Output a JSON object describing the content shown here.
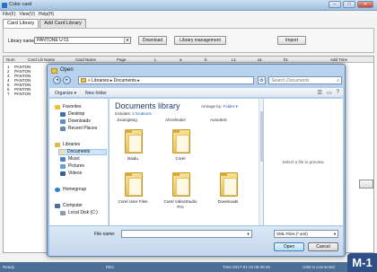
{
  "app": {
    "title": "Color card",
    "menu": [
      "File(F)",
      "View(V)",
      "Help(H)"
    ],
    "tabs": [
      "Card Library",
      "Add Card Library"
    ],
    "library_label": "Library name:",
    "library_value": "PANTONE U 01",
    "buttons": {
      "download": "Download",
      "library_management": "Library management",
      "import": "Import"
    },
    "table_headers": [
      "Num",
      "Card Lib",
      "Name",
      "Card Name",
      "Page",
      "L",
      "a",
      "b",
      "L1",
      "a1",
      "b1",
      "Add Time"
    ],
    "rows": [
      {
        "num": "1",
        "lib": "PANTON"
      },
      {
        "num": "2",
        "lib": "PANTON"
      },
      {
        "num": "3",
        "lib": "PANTON"
      },
      {
        "num": "4",
        "lib": "PANTON"
      },
      {
        "num": "5",
        "lib": "PANTON"
      },
      {
        "num": "6",
        "lib": "PANTON"
      },
      {
        "num": "7",
        "lib": "PANTON"
      }
    ],
    "status": {
      "left": "Ready",
      "middle": "REC",
      "time": "Time:2017-01-23 09:49:45",
      "usb": "USB is connected"
    },
    "badge": "M-1"
  },
  "dialog": {
    "title": "Open",
    "breadcrumb": "» Libraries ▸ Documents ▸",
    "search_placeholder": "Search Documents",
    "organize": "Organize ▾",
    "new_folder": "New folder",
    "nav": {
      "favorites": "Favorites",
      "desktop": "Desktop",
      "downloads": "Downloads",
      "recent": "Recent Places",
      "libraries": "Libraries",
      "documents": "Documents",
      "music": "Music",
      "pictures": "Pictures",
      "videos": "Videos",
      "homegroup": "Homegroup",
      "computer": "Computer",
      "local_disk": "Local Disk (C:)"
    },
    "library_title": "Documents library",
    "includes_prefix": "Includes: ",
    "includes_link": "2 locations",
    "arrange_label": "Arrange by: ",
    "arrange_value": "Folder ▾",
    "cut_headers": [
      "Jixiangtang",
      "Ahrrelinden",
      "Autodesk"
    ],
    "folders": [
      {
        "name": "Baidu"
      },
      {
        "name": "Corel"
      },
      {
        "name": "Corel User Files"
      },
      {
        "name": "Corel VideoStudio Pro"
      },
      {
        "name": "Downloads"
      }
    ],
    "preview_msg": "Select a file to preview.",
    "filename_label": "File name:",
    "filename_value": "",
    "filetype": "XML Files (*.xml)",
    "open": "Open",
    "cancel": "Cancel"
  },
  "colors": {
    "accent": "#4c6f97",
    "folder": "#e4b845",
    "link": "#1c5fb6"
  }
}
